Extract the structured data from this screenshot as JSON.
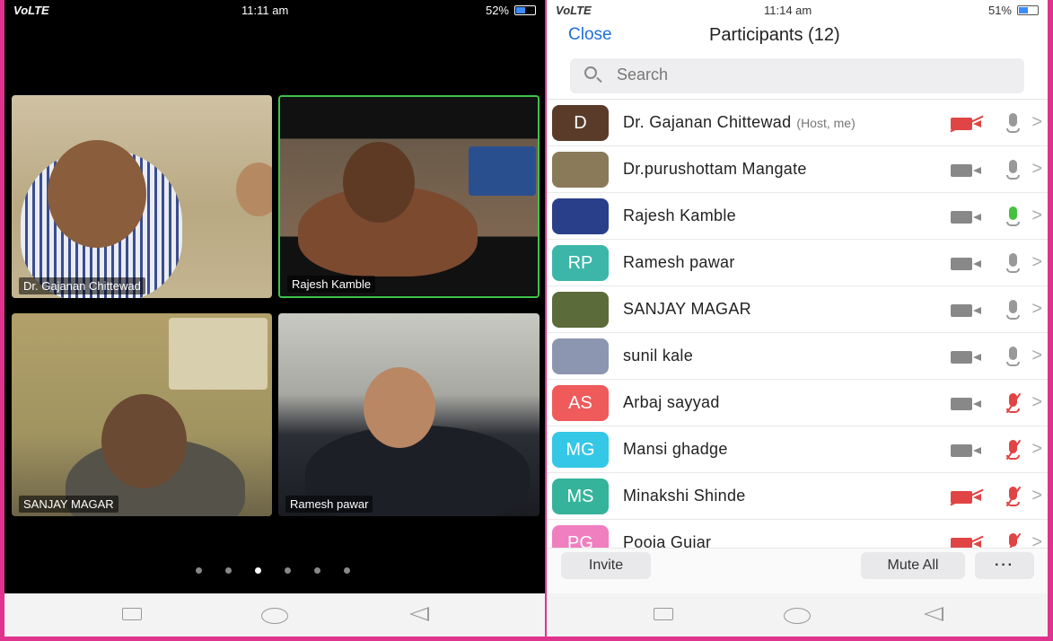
{
  "left_phone": {
    "status": {
      "carrier": "VoLTE",
      "time": "11:11 am",
      "battery": "52%"
    },
    "tiles": [
      {
        "name": "Dr. Gajanan Chittewad"
      },
      {
        "name": "Rajesh Kamble",
        "active": true
      },
      {
        "name": "SANJAY MAGAR"
      },
      {
        "name": "Ramesh pawar"
      }
    ],
    "page_dots": {
      "count": 6,
      "active_index": 2
    }
  },
  "right_phone": {
    "status": {
      "carrier": "VoLTE",
      "time": "11:14 am",
      "battery": "51%"
    },
    "header": {
      "close_label": "Close",
      "title": "Participants (12)"
    },
    "search": {
      "placeholder": "Search"
    },
    "participants": [
      {
        "initials": "D",
        "avatar_color": "#5a3b2a",
        "name": "Dr. Gajanan Chittewad",
        "tag": "(Host, me)",
        "video": "off",
        "audio": "idle"
      },
      {
        "initials": "",
        "avatar_color": "#8a7a5a",
        "name": "Dr.purushottam Mangate",
        "tag": "",
        "video": "on",
        "audio": "idle"
      },
      {
        "initials": "",
        "avatar_color": "#2a3f8a",
        "name": "Rajesh Kamble",
        "tag": "",
        "video": "on",
        "audio": "speaking"
      },
      {
        "initials": "RP",
        "avatar_color": "#3cb6a8",
        "name": "Ramesh pawar",
        "tag": "",
        "video": "on",
        "audio": "idle"
      },
      {
        "initials": "",
        "avatar_color": "#5b6b3a",
        "name": "SANJAY MAGAR",
        "tag": "",
        "video": "on",
        "audio": "idle"
      },
      {
        "initials": "",
        "avatar_color": "#8d96b0",
        "name": "sunil kale",
        "tag": "",
        "video": "on",
        "audio": "idle"
      },
      {
        "initials": "AS",
        "avatar_color": "#ef5a5a",
        "name": "Arbaj sayyad",
        "tag": "",
        "video": "on",
        "audio": "muted"
      },
      {
        "initials": "MG",
        "avatar_color": "#35c7e6",
        "name": "Mansi ghadge",
        "tag": "",
        "video": "on",
        "audio": "muted"
      },
      {
        "initials": "MS",
        "avatar_color": "#36b39b",
        "name": "Minakshi Shinde",
        "tag": "",
        "video": "off",
        "audio": "muted"
      },
      {
        "initials": "PG",
        "avatar_color": "#f07fbf",
        "name": "Pooja Gujar",
        "tag": "",
        "video": "off",
        "audio": "muted"
      }
    ],
    "footer": {
      "invite_label": "Invite",
      "mute_all_label": "Mute All",
      "more_label": "···"
    }
  }
}
